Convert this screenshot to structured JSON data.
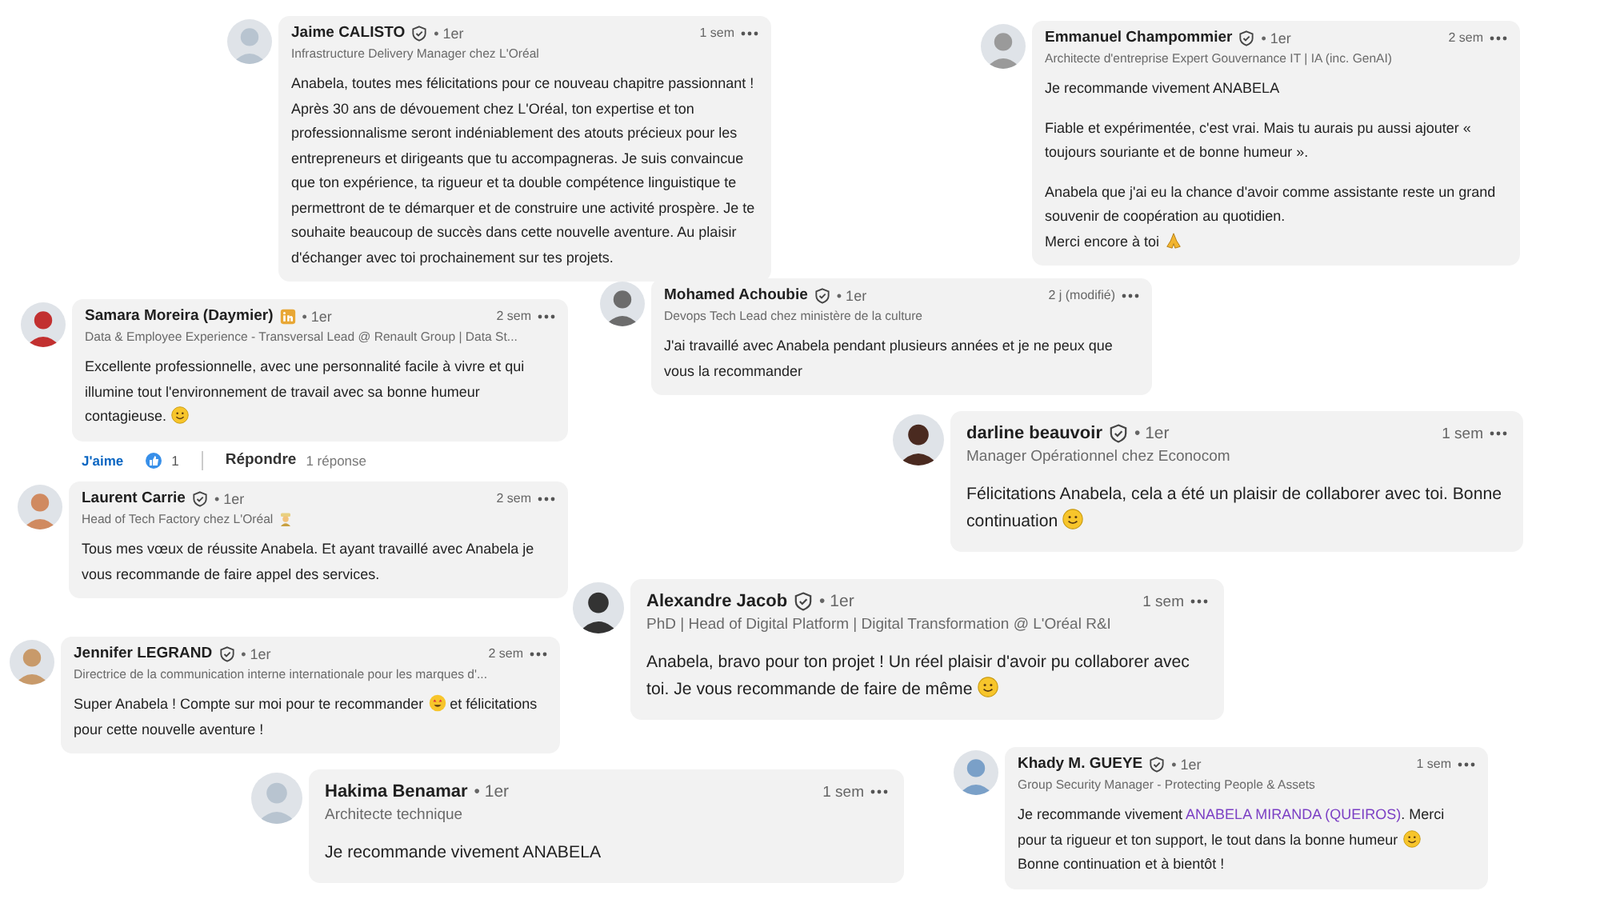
{
  "comments": [
    {
      "kind": "compact",
      "name": "Jaime CALISTO",
      "badge": {
        "kind": "verified"
      },
      "degree": "• 1er",
      "time": "1 sem",
      "headline": "Infrastructure Delivery Manager chez L'Oréal",
      "paragraphs": [
        [
          {
            "text": "Anabela, toutes mes félicitations pour ce nouveau chapitre passionnant ! Après 30 ans de dévouement chez L'Oréal, ton expertise et ton professionnalisme seront indéniablement des atouts précieux pour les entrepreneurs et dirigeants que tu accompagneras. Je suis convaincue que ton expérience, ta rigueur et ta double compétence linguistique te permettront de te démarquer et de construire une activité prospère. Je te souhaite beaucoup de succès dans cette nouvelle aventure. Au plaisir d'échanger avec toi prochainement sur tes projets."
          }
        ]
      ]
    },
    {
      "kind": "compact",
      "name": "Emmanuel Champommier",
      "badge": {
        "kind": "verified"
      },
      "degree": "• 1er",
      "time": "2 sem",
      "headline": "Architecte d'entreprise Expert Gouvernance IT | IA (inc. GenAI)",
      "paragraphs": [
        [
          {
            "text": "Je recommande vivement ANABELA"
          }
        ],
        [
          {
            "text": "Fiable et expérimentée, c'est vrai. Mais tu aurais pu aussi ajouter « toujours souriante et de bonne humeur »."
          }
        ],
        [
          {
            "text": "Anabela que j'ai eu la chance d'avoir comme assistante reste un grand souvenir de coopération au quotidien."
          },
          {
            "text": "Merci encore à toi",
            "emoji": {
              "kind": "pray"
            }
          }
        ]
      ]
    },
    {
      "kind": "compact",
      "name": "Samara Moreira (Daymier)",
      "badge": {
        "kind": "premium"
      },
      "degree": "• 1er",
      "time": "2 sem",
      "headline": "Data & Employee Experience - Transversal Lead @ Renault Group | Data St...",
      "paragraphs": [
        [
          {
            "text": "Excellente professionnelle, avec une personnalité facile à vivre et qui illumine tout l'environnement de travail avec sa bonne humeur contagieuse.",
            "emoji": {
              "kind": "smile"
            }
          }
        ]
      ],
      "actions": {
        "like": "J'aime",
        "reactions": "1",
        "reply": "Répondre",
        "replies": "1 réponse"
      }
    },
    {
      "kind": "compact",
      "name": "Mohamed Achoubie",
      "badge": {
        "kind": "verified"
      },
      "degree": "• 1er",
      "time": "2 j (modifié)",
      "headline": "Devops Tech Lead chez ministère de la culture",
      "paragraphs": [
        [
          {
            "text": "J'ai travaillé avec Anabela pendant plusieurs années et je ne peux que vous la recommander"
          }
        ]
      ]
    },
    {
      "kind": "large",
      "name": "darline beauvoir",
      "badge": {
        "kind": "verified"
      },
      "degree": "• 1er",
      "time": "1 sem",
      "headline": "Manager Opérationnel chez Econocom",
      "paragraphs": [
        [
          {
            "text": "Félicitations Anabela, cela a été un plaisir de collaborer avec toi. Bonne continuation",
            "emoji": {
              "kind": "smile"
            }
          }
        ]
      ]
    },
    {
      "kind": "compact",
      "name": "Laurent Carrie",
      "badge": {
        "kind": "verified"
      },
      "degree": "• 1er",
      "time": "2 sem",
      "headline": "Head of Tech Factory chez L'Oréal",
      "headline_emoji": {
        "kind": "person"
      },
      "paragraphs": [
        [
          {
            "text": "Tous mes vœux de réussite Anabela. Et ayant travaillé avec Anabela je vous recommande de faire appel des services."
          }
        ]
      ]
    },
    {
      "kind": "compact",
      "name": "Jennifer LEGRAND",
      "badge": {
        "kind": "verified"
      },
      "degree": "• 1er",
      "time": "2 sem",
      "headline": "Directrice de la communication interne internationale pour les marques d'...",
      "paragraphs": [
        [
          {
            "text": "Super Anabela ! Compte sur moi pour te recommander",
            "emoji": {
              "kind": "love"
            },
            "after": " et félicitations pour cette nouvelle aventure !"
          }
        ]
      ]
    },
    {
      "kind": "large",
      "name": "Alexandre Jacob",
      "badge": {
        "kind": "verified"
      },
      "degree": "• 1er",
      "time": "1 sem",
      "headline": "PhD | Head of Digital Platform | Digital Transformation @ L'Oréal R&I",
      "paragraphs": [
        [
          {
            "text": "Anabela, bravo pour ton projet ! Un réel plaisir d'avoir pu collaborer avec toi. Je vous recommande de faire de même",
            "emoji": {
              "kind": "smile"
            }
          }
        ]
      ]
    },
    {
      "kind": "large",
      "name": "Hakima Benamar",
      "degree": "• 1er",
      "time": "1 sem",
      "headline": "Architecte technique",
      "paragraphs": [
        [
          {
            "text": "Je recommande vivement ANABELA"
          }
        ]
      ]
    },
    {
      "kind": "compact",
      "name": "Khady M. GUEYE",
      "badge": {
        "kind": "verified"
      },
      "degree": "• 1er",
      "time": "1 sem",
      "headline": "Group Security Manager - Protecting People & Assets",
      "paragraphs": [
        [
          {
            "text": "Je recommande vivement ",
            "link": "ANABELA MIRANDA (QUEIROS)",
            "after": ". Merci pour ta rigueur et ton support, le tout dans la bonne humeur",
            "emoji": {
              "kind": "smile"
            }
          },
          {
            "text": "Bonne continuation et à bientôt !"
          }
        ]
      ]
    }
  ]
}
